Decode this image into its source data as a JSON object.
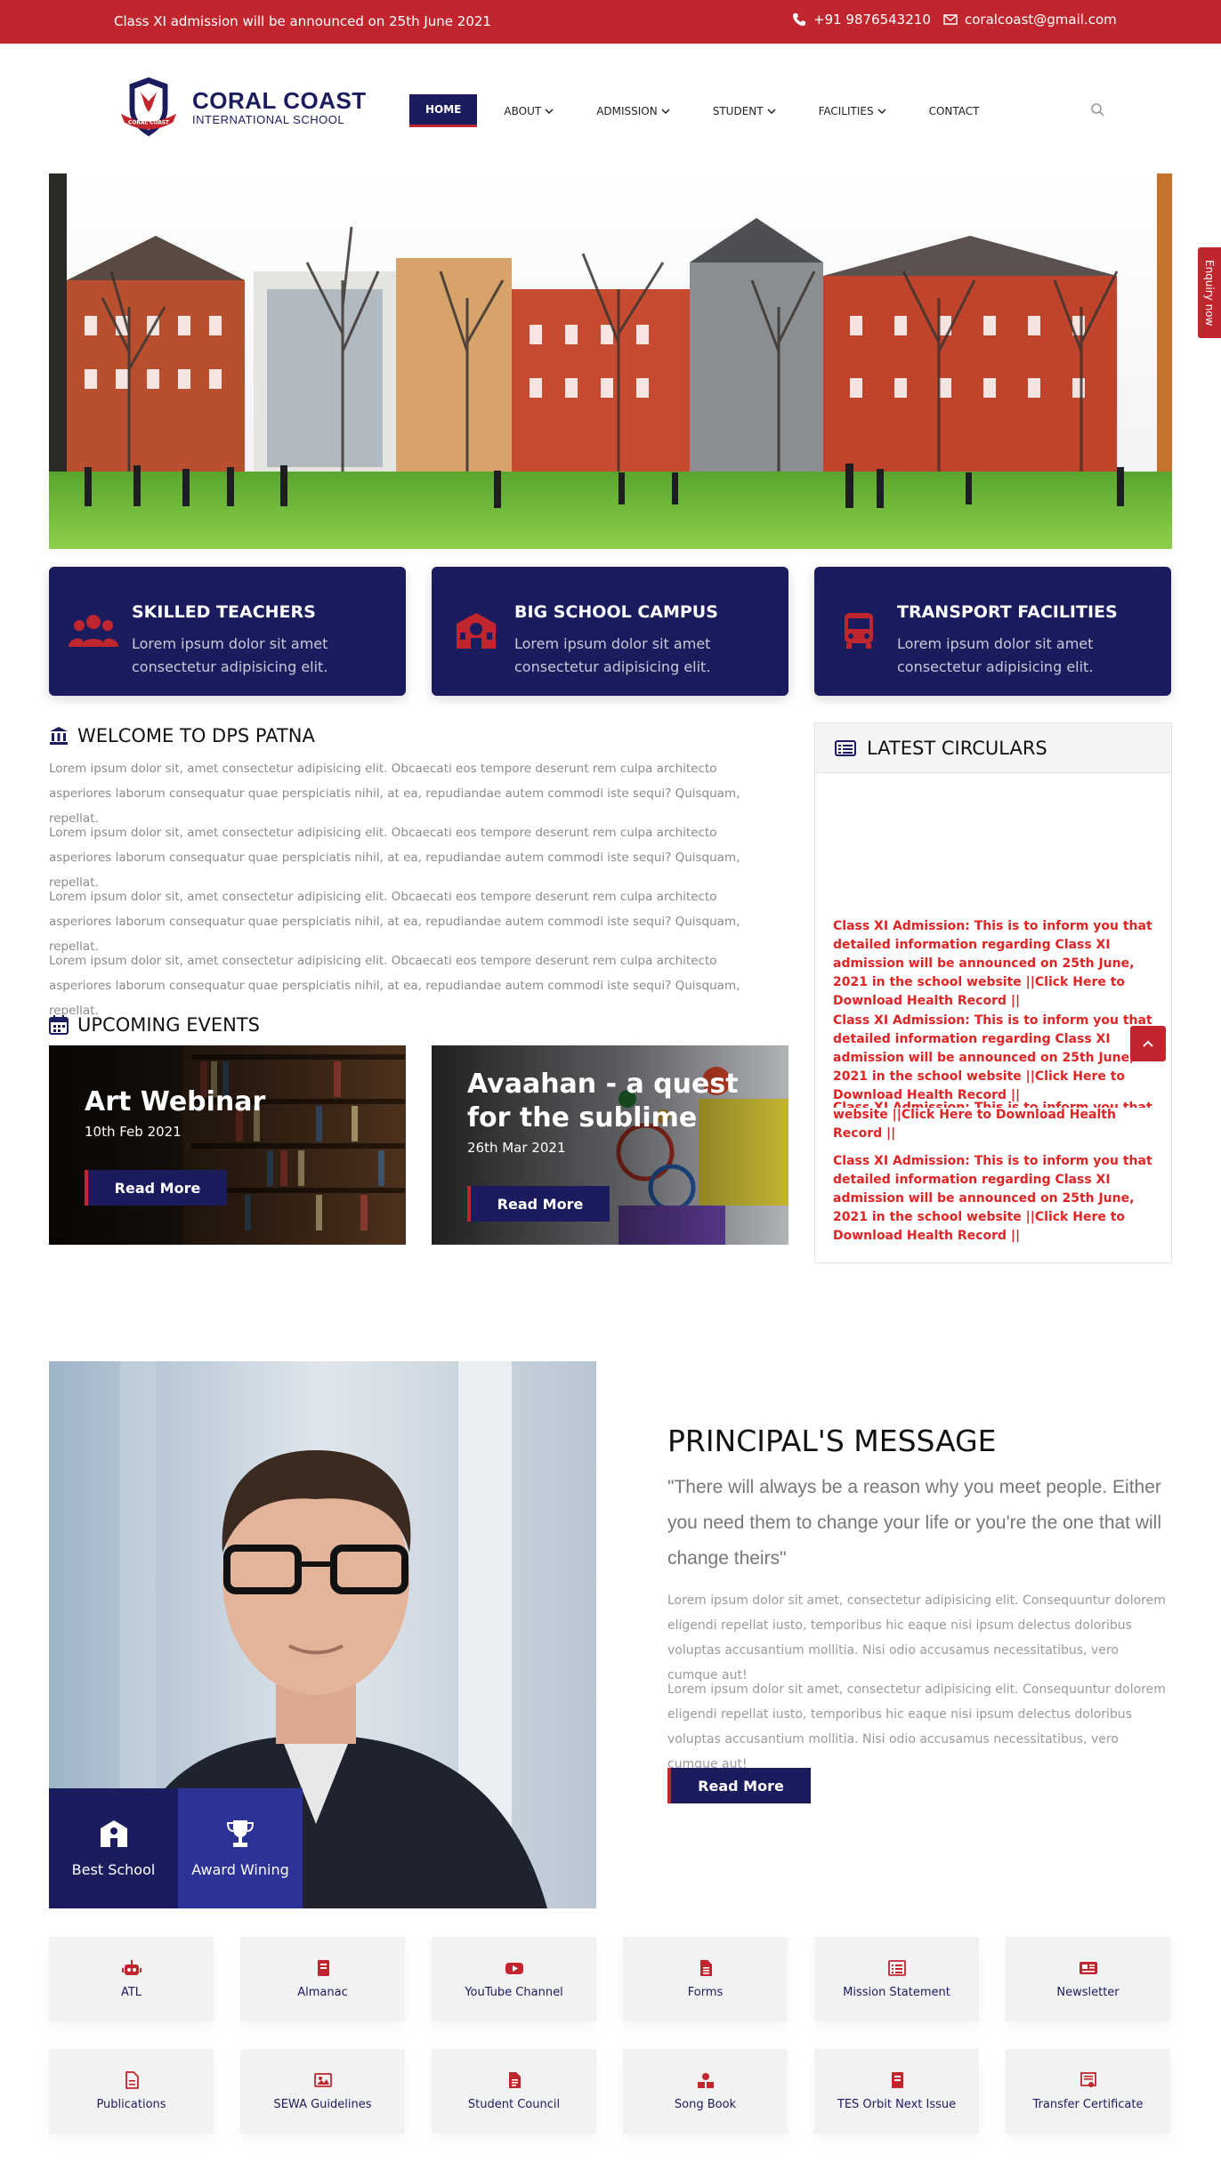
{
  "topbar": {
    "announcement": "Class XI admission will be announced on 25th June 2021",
    "phone": "+91 9876543210",
    "email": "coralcoast@gmail.com"
  },
  "logo": {
    "name": "CORAL COAST",
    "subtitle": "INTERNATIONAL SCHOOL",
    "crest_text": "CORAL COAST"
  },
  "nav": {
    "items": [
      {
        "label": "HOME",
        "active": true
      },
      {
        "label": "ABOUT",
        "dropdown": true
      },
      {
        "label": "ADMISSION",
        "dropdown": true
      },
      {
        "label": "STUDENT",
        "dropdown": true
      },
      {
        "label": "FACILITIES",
        "dropdown": true
      },
      {
        "label": "CONTACT"
      }
    ]
  },
  "enquiry_tab": "Enquiry now",
  "features": [
    {
      "title": "SKILLED TEACHERS",
      "text": "Lorem ipsum dolor sit amet consectetur adipisicing elit.",
      "icon": "users-icon"
    },
    {
      "title": "BIG SCHOOL CAMPUS",
      "text": "Lorem ipsum dolor sit amet consectetur adipisicing elit.",
      "icon": "school-icon"
    },
    {
      "title": "TRANSPORT FACILITIES",
      "text": "Lorem ipsum dolor sit amet consectetur adipisicing elit.",
      "icon": "bus-icon"
    }
  ],
  "welcome": {
    "title": "WELCOME TO DPS PATNA",
    "paragraphs": [
      "Lorem ipsum dolor sit, amet consectetur adipisicing elit. Obcaecati eos tempore deserunt rem culpa architecto asperiores laborum consequatur quae perspiciatis nihil, at ea, repudiandae autem commodi iste sequi? Quisquam, repellat.",
      "Lorem ipsum dolor sit, amet consectetur adipisicing elit. Obcaecati eos tempore deserunt rem culpa architecto asperiores laborum consequatur quae perspiciatis nihil, at ea, repudiandae autem commodi iste sequi? Quisquam, repellat.",
      "Lorem ipsum dolor sit, amet consectetur adipisicing elit. Obcaecati eos tempore deserunt rem culpa architecto asperiores laborum consequatur quae perspiciatis nihil, at ea, repudiandae autem commodi iste sequi? Quisquam, repellat.",
      "Lorem ipsum dolor sit, amet consectetur adipisicing elit. Obcaecati eos tempore deserunt rem culpa architecto asperiores laborum consequatur quae perspiciatis nihil, at ea, repudiandae autem commodi iste sequi? Quisquam, repellat."
    ]
  },
  "events": {
    "title": "UPCOMING EVENTS",
    "items": [
      {
        "title": "Art Webinar",
        "date": "10th Feb 2021",
        "button": "Read More"
      },
      {
        "title": "Avaahan - a quest for the sublime",
        "date": "26th Mar 2021",
        "button": "Read More"
      }
    ]
  },
  "circulars": {
    "title": "LATEST CIRCULARS",
    "items": [
      "Class XI Admission: This is to inform you that detailed information regarding Class XI admission will be announced on 25th June, 2021 in the school website ||Click Here to Download Health Record ||",
      "Class XI Admission: This is to inform you that detailed information regarding Class XI admission will be announced on 25th June, 2021 in the school website ||Click Here to Download Health Record ||",
      "Class XI Admission: This is to inform you that",
      "website ||Click Here to Download Health Record ||",
      "Class XI Admission: This is to inform you that detailed information regarding Class XI admission will be announced on 25th June, 2021 in the school website ||Click Here to Download Health Record ||"
    ]
  },
  "principal": {
    "title": "PRINCIPAL'S MESSAGE",
    "quote": "\"There will always be a reason why you meet people. Either you need them to change your life or you're the one that will change theirs\"",
    "paragraphs": [
      "Lorem ipsum dolor sit amet, consectetur adipisicing elit. Consequuntur dolorem eligendi repellat iusto, temporibus hic eaque nisi ipsum delectus doloribus voluptas accusantium mollitia. Nisi odio accusamus necessitatibus, vero cumque aut!",
      "Lorem ipsum dolor sit amet, consectetur adipisicing elit. Consequuntur dolorem eligendi repellat iusto, temporibus hic eaque nisi ipsum delectus doloribus voluptas accusantium mollitia. Nisi odio accusamus necessitatibus, vero cumque aut!"
    ],
    "button": "Read More",
    "badges": [
      {
        "label": "Best School",
        "icon": "school-icon"
      },
      {
        "label": "Award Wining",
        "icon": "trophy-icon"
      }
    ]
  },
  "quick_links": [
    {
      "label": "ATL",
      "icon": "robot-icon"
    },
    {
      "label": "Almanac",
      "icon": "book-icon"
    },
    {
      "label": "YouTube Channel",
      "icon": "youtube-icon"
    },
    {
      "label": "Forms",
      "icon": "form-icon"
    },
    {
      "label": "Mission Statement",
      "icon": "list-icon"
    },
    {
      "label": "Newsletter",
      "icon": "newspaper-icon"
    },
    {
      "label": "Publications",
      "icon": "document-icon"
    },
    {
      "label": "SEWA Guidelines",
      "icon": "image-icon"
    },
    {
      "label": "Student Council",
      "icon": "file-icon"
    },
    {
      "label": "Song Book",
      "icon": "hands-icon"
    },
    {
      "label": "TES Orbit Next Issue",
      "icon": "book-icon"
    },
    {
      "label": "Transfer Certificate",
      "icon": "certificate-icon"
    }
  ],
  "colors": {
    "primary_navy": "#1b1c5e",
    "accent_red": "#c1262e",
    "circular_red": "#e02424"
  }
}
